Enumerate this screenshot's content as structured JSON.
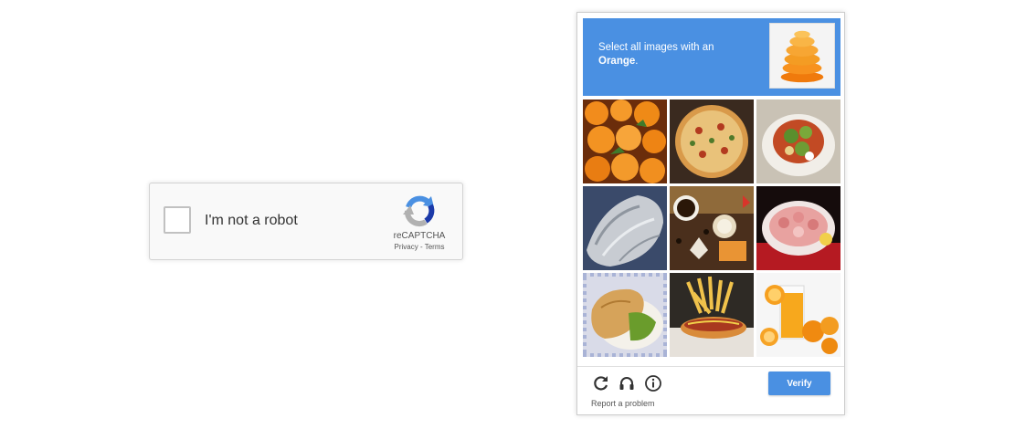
{
  "widget": {
    "checkbox_label": "I'm not a robot",
    "brand_name": "reCAPTCHA",
    "privacy_link": "Privacy",
    "separator": " - ",
    "terms_link": "Terms",
    "logo_icon": "recaptcha-logo-icon",
    "colors": {
      "logo_blue": "#1c3aa9",
      "logo_lightblue": "#4a90e2",
      "logo_gray": "#b1b1b1"
    }
  },
  "challenge": {
    "instruction_prefix": "Select all images with an",
    "target_word": "Orange",
    "instruction_suffix": ".",
    "sample_image": "orange-slices-image",
    "tiles": [
      {
        "image": "mandarin-oranges-image",
        "selected": false
      },
      {
        "image": "pizza-image",
        "selected": false
      },
      {
        "image": "salad-plate-image",
        "selected": false
      },
      {
        "image": "foil-wrapped-food-image",
        "selected": false
      },
      {
        "image": "cookies-and-coffee-image",
        "selected": false
      },
      {
        "image": "shrimp-platter-image",
        "selected": false
      },
      {
        "image": "sandwich-image",
        "selected": false
      },
      {
        "image": "hot-dog-and-fries-image",
        "selected": false
      },
      {
        "image": "orange-juice-image",
        "selected": false
      }
    ],
    "controls": [
      {
        "icon": "reload-icon"
      },
      {
        "icon": "headphones-icon"
      },
      {
        "icon": "info-icon"
      }
    ],
    "report_link": "Report a problem",
    "verify_button": "Verify",
    "colors": {
      "accent": "#4a90e2"
    }
  }
}
